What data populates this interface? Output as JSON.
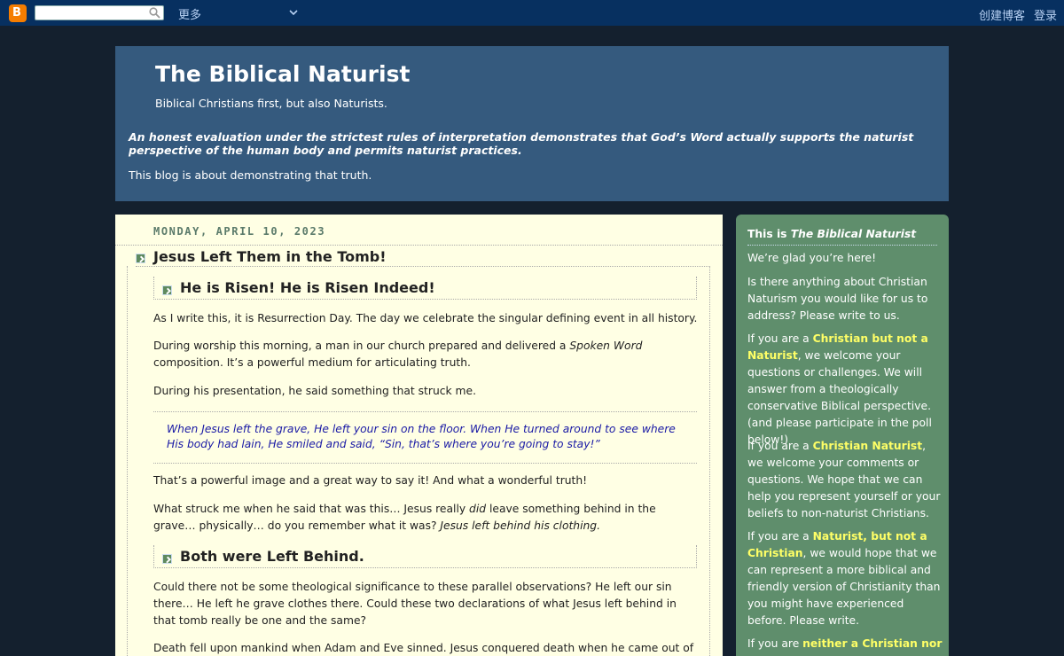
{
  "navbar": {
    "logo_letter": "B",
    "search_placeholder": "",
    "more_label": "更多",
    "create_blog": "创建博客",
    "login": "登录"
  },
  "header": {
    "title": "The Biblical Naturist",
    "tagline": "Biblical Christians first, but also Naturists.",
    "description_italic": "An honest evaluation under the strictest rules of interpretation demonstrates that God’s Word actually supports the naturist perspective of the human body and permits naturist practices.",
    "description": "This blog is about demonstrating that truth."
  },
  "post": {
    "date": "MONDAY, APRIL 10, 2023",
    "title": "Jesus Left Them in the Tomb!",
    "heading1": "He is Risen! He is Risen Indeed!",
    "p1": "As I write this, it is Resurrection Day. The day we celebrate the singular defining event in all history.",
    "p2_a": "During worship this morning, a man in our church prepared and delivered a ",
    "p2_em": "Spoken Word",
    "p2_b": " composition. It’s a powerful medium for articulating truth.",
    "p3": "During his presentation, he said something that struck me.",
    "quote": "When Jesus left the grave, He left your sin on the floor. When He turned around to see where His body had lain, He smiled and said, “Sin, that’s where you’re going to stay!”",
    "p4": "That’s a powerful image and a great way to say it! And what a wonderful truth!",
    "p5_a": "What struck me when he said that was this… Jesus really ",
    "p5_em1": "did",
    "p5_b": " leave something behind in the grave… physically… do you remember what it was? ",
    "p5_em2": "Jesus left behind his clothing.",
    "heading2": "Both were Left Behind.",
    "p6": "Could there not be some theological significance to these parallel observations? He left our sin there… He left he grave clothes there. Could these two declarations of what Jesus left behind in that tomb really be one and the same?",
    "p7": "Death fell upon mankind when Adam and Eve sinned. Jesus conquered death when he came out of that"
  },
  "sidebar": {
    "title_a": "This is ",
    "title_em": "The Biblical Naturist",
    "welcome": "We’re glad you’re here!",
    "ask": "Is there anything about Christian Naturism you would like for us to address? Please write to us.",
    "c1_a": "If you are a ",
    "c1_hl": "Christian but not a Naturist",
    "c1_b": ", we welcome your questions or challenges. We will answer from a theologically conservative Biblical perspective. (and please participate in the poll below!)",
    "c2_a": "If you are a ",
    "c2_hl": "Christian Naturist",
    "c2_b": ", we welcome your comments or questions. We hope that we can help you represent yourself or your beliefs to non-naturist Christians.",
    "c3_a": "If you are a ",
    "c3_hl": "Naturist, but not a Christian",
    "c3_b": ", we would hope that we can represent a more biblical and friendly version of Christianity than you might have experienced before. Please write.",
    "c4_a": "If you are ",
    "c4_hl": "neither a Christian nor a"
  },
  "colors": {
    "navbar": "#073060",
    "header": "#355a7e",
    "main_bg": "#ffffe4",
    "sidebar_bg": "#5f8e6c",
    "highlight": "#ffff66",
    "quote": "#1a1aa5"
  }
}
